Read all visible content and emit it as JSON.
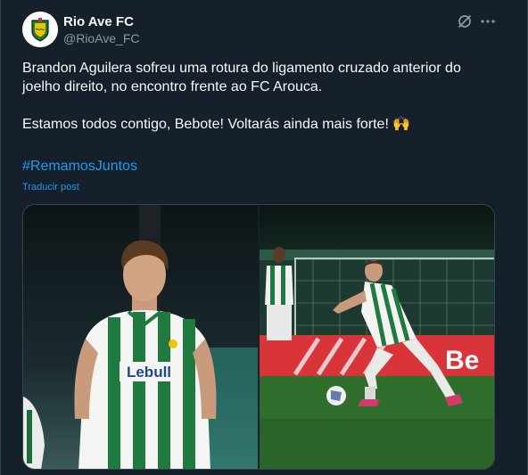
{
  "account": {
    "display_name": "Rio Ave FC",
    "handle": "@RioAve_FC"
  },
  "icons": {
    "grok": "grok-icon",
    "more": "more-icon",
    "emoji": "raised-hands-emoji"
  },
  "tweet": {
    "line1": "Brandon Aguilera sofreu uma rotura do ligamento cruzado anterior do",
    "line2": "joelho direito, no encontro frente ao FC Arouca.",
    "line3": "Estamos todos contigo, Bebote! Voltarás ainda mais forte! 🙌",
    "hashtag": "#RemamosJuntos",
    "translate": "Traducir post"
  },
  "media": {
    "photo1_shirt_text": "Lebull",
    "photo2_board_text": "Be"
  },
  "colors": {
    "background": "#15202b",
    "text": "#f7f9f9",
    "secondary": "#8b98a5",
    "link": "#1d9bf0",
    "border": "#38444d"
  }
}
